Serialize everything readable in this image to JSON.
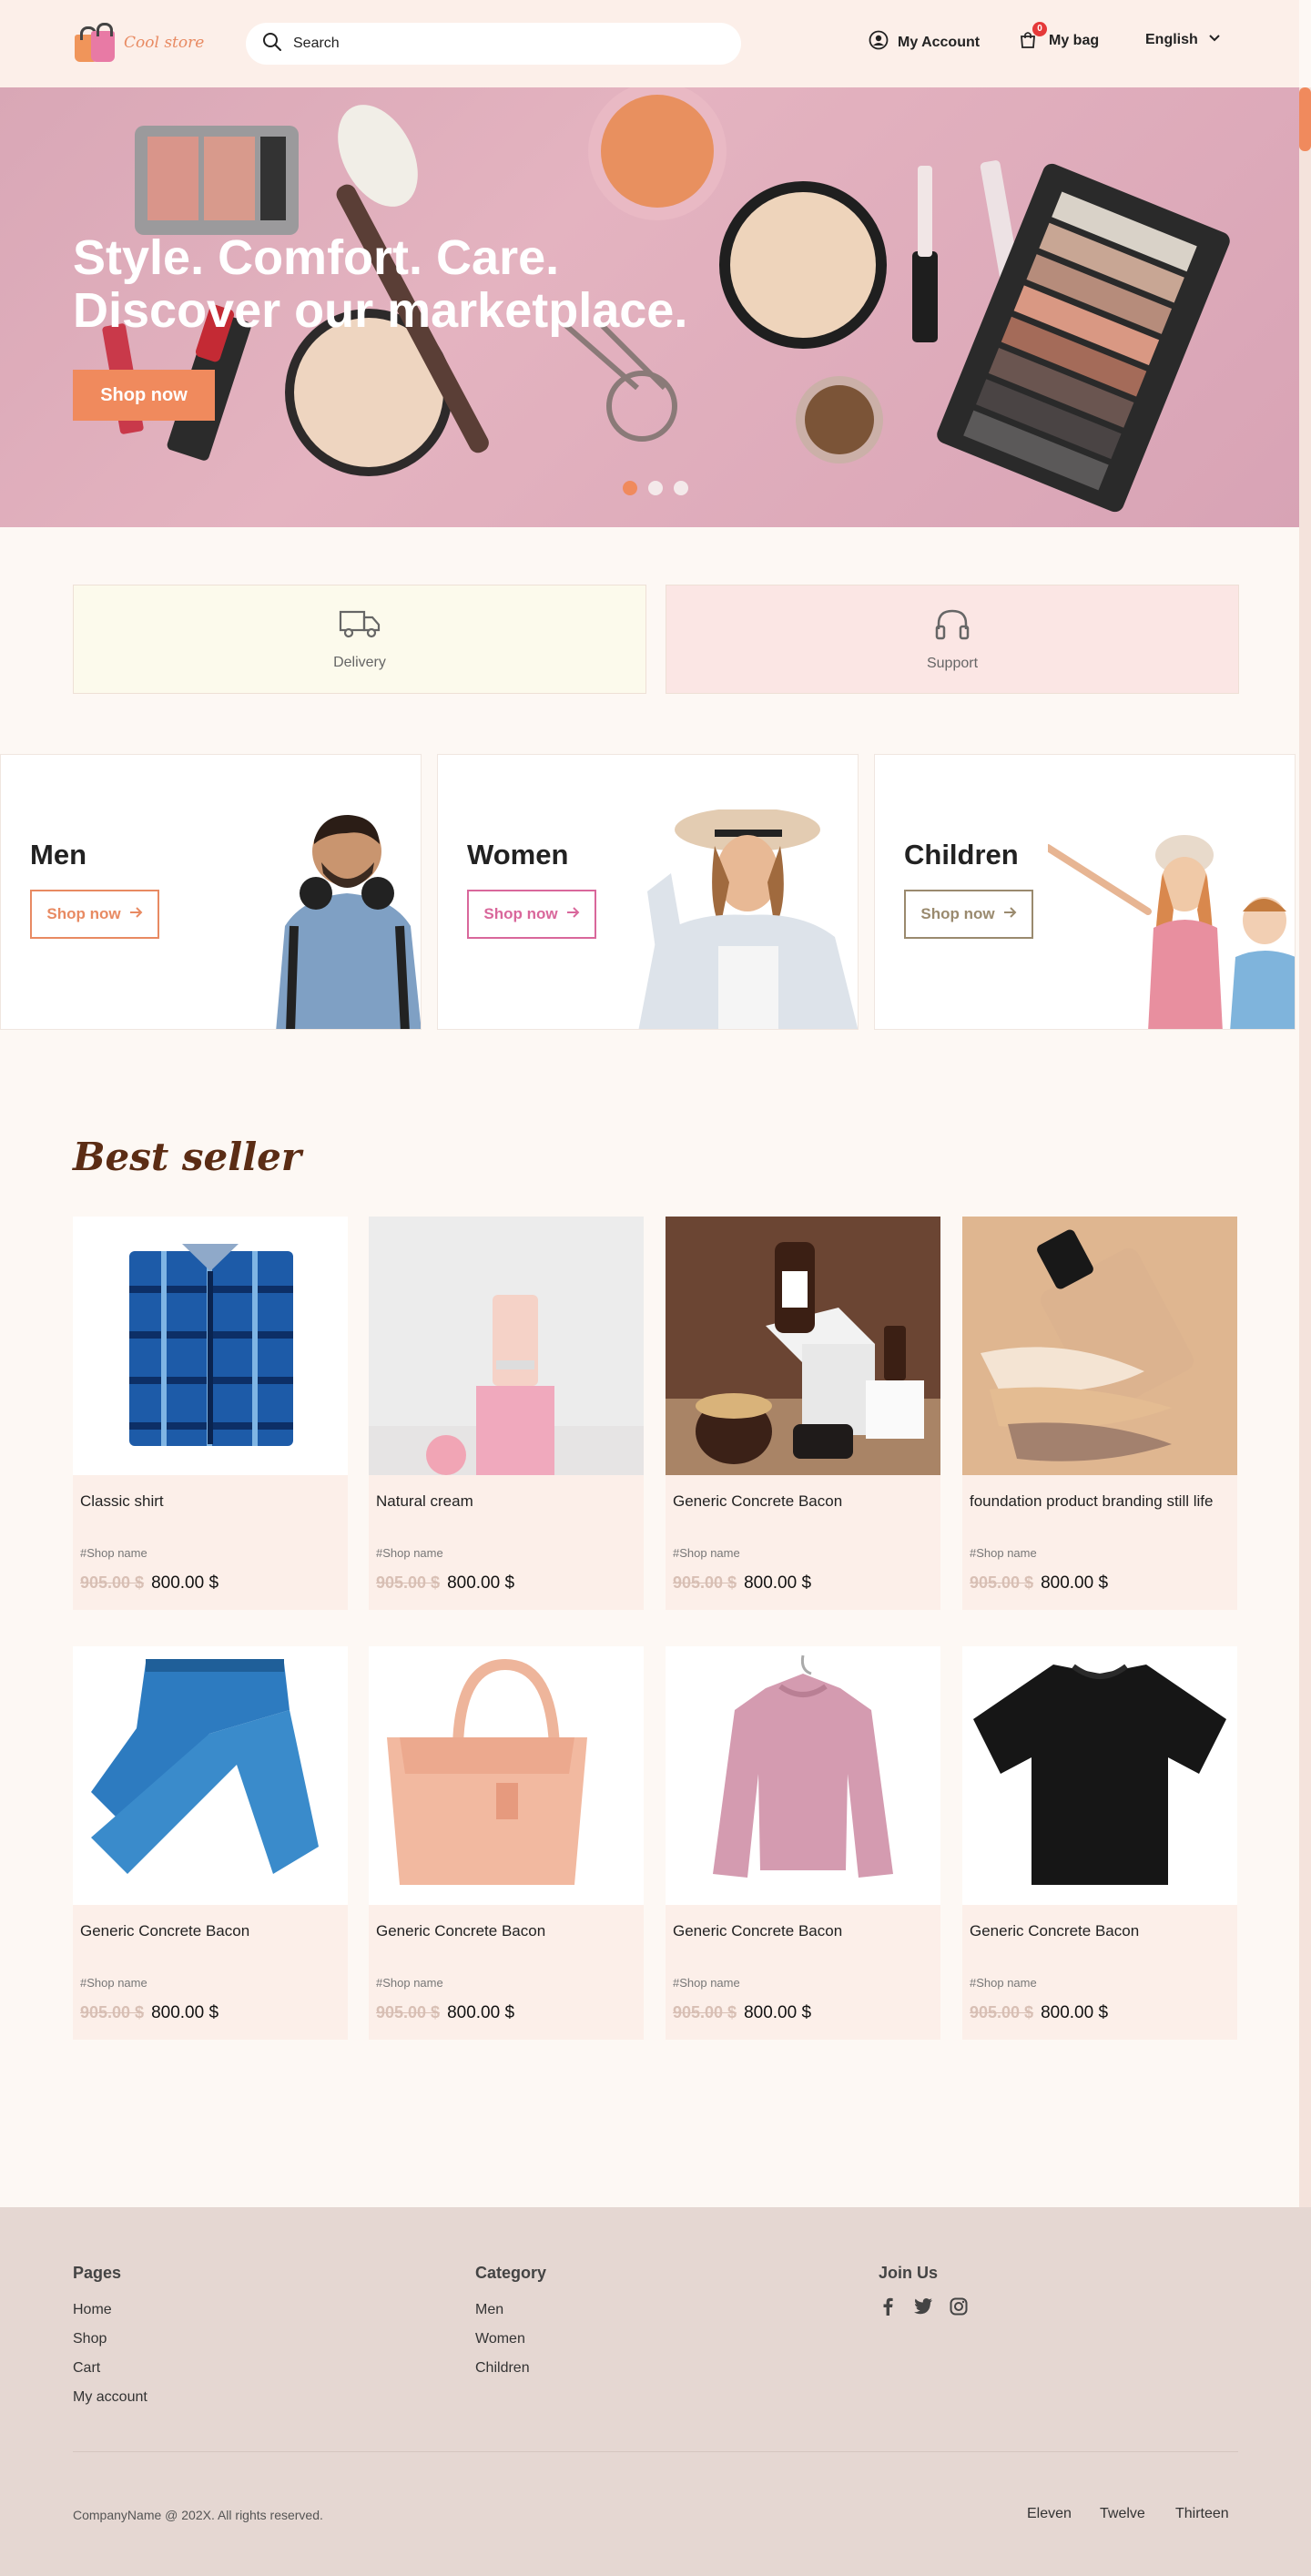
{
  "header": {
    "logo_text": "Cool store",
    "search_placeholder": "Search",
    "account_label": "My Account",
    "bag_label": "My bag",
    "bag_count": "0",
    "language": "English"
  },
  "hero": {
    "title": "Style. Comfort. Care. Discover our marketplace.",
    "button_label": "Shop now",
    "slides": 3,
    "active_slide": 1
  },
  "features": [
    {
      "label": "Delivery",
      "icon": "truck-icon"
    },
    {
      "label": "Support",
      "icon": "headphones-icon"
    }
  ],
  "categories": [
    {
      "title": "Men",
      "button": "Shop now",
      "color": "#e88a62"
    },
    {
      "title": "Women",
      "button": "Shop now",
      "color": "#d9679b"
    },
    {
      "title": "Children",
      "button": "Shop now",
      "color": "#9a8a6e"
    }
  ],
  "best_seller": {
    "title": "Best seller",
    "products": [
      {
        "name": "Classic shirt",
        "shop": "#Shop name",
        "old_price": "905.00 $",
        "price": "800.00 $"
      },
      {
        "name": "Natural cream",
        "shop": "#Shop name",
        "old_price": "905.00 $",
        "price": "800.00 $"
      },
      {
        "name": "Generic Concrete Bacon",
        "shop": "#Shop name",
        "old_price": "905.00 $",
        "price": "800.00 $"
      },
      {
        "name": "foundation product branding still life",
        "shop": "#Shop name",
        "old_price": "905.00 $",
        "price": "800.00 $"
      },
      {
        "name": "Generic Concrete Bacon",
        "shop": "#Shop name",
        "old_price": "905.00 $",
        "price": "800.00 $"
      },
      {
        "name": "Generic Concrete Bacon",
        "shop": "#Shop name",
        "old_price": "905.00 $",
        "price": "800.00 $"
      },
      {
        "name": "Generic Concrete Bacon",
        "shop": "#Shop name",
        "old_price": "905.00 $",
        "price": "800.00 $"
      },
      {
        "name": "Generic Concrete Bacon",
        "shop": "#Shop name",
        "old_price": "905.00 $",
        "price": "800.00 $"
      }
    ]
  },
  "footer": {
    "pages_title": "Pages",
    "pages": [
      "Home",
      "Shop",
      "Cart",
      "My account"
    ],
    "category_title": "Category",
    "category_links": [
      "Men",
      "Women",
      "Children"
    ],
    "join_title": "Join Us",
    "social_icons": [
      "facebook-icon",
      "twitter-icon",
      "instagram-icon"
    ],
    "copyright": "CompanyName @ 202X. All rights reserved.",
    "bottom_links": [
      "Eleven",
      "Twelve",
      "Thirteen"
    ]
  },
  "colors": {
    "accent": "#f08a5d",
    "header_bg": "#fcefe9",
    "footer_bg": "#e5d7d2",
    "title_brown": "#5b2c14"
  }
}
